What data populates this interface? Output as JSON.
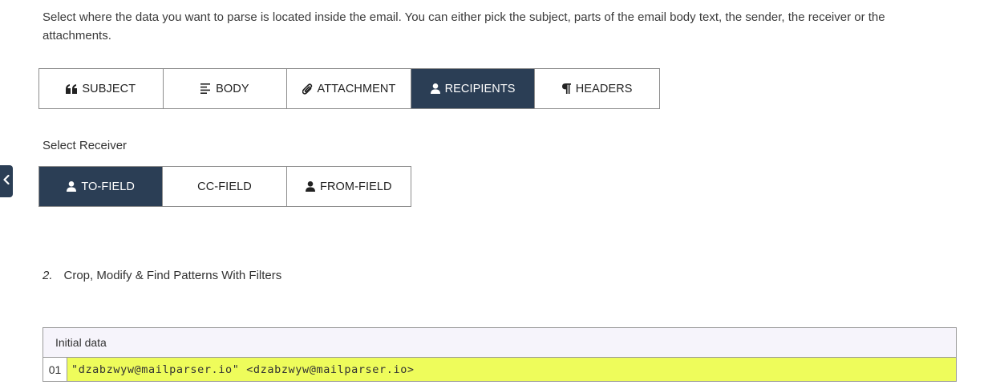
{
  "intro": {
    "text": "Select where the data you want to parse is located inside the email. You can either pick the subject, parts of the email body text, the sender, the receiver or the attachments."
  },
  "source_tabs": [
    {
      "label": "SUBJECT",
      "icon": "quote-icon",
      "active": false
    },
    {
      "label": "BODY",
      "icon": "align-left-icon",
      "active": false
    },
    {
      "label": "ATTACHMENT",
      "icon": "paperclip-icon",
      "active": false
    },
    {
      "label": "RECIPIENTS",
      "icon": "user-icon",
      "active": true
    },
    {
      "label": "HEADERS",
      "icon": "paragraph-icon",
      "active": false
    }
  ],
  "receiver": {
    "label": "Select Receiver",
    "tabs": [
      {
        "label": "TO-FIELD",
        "icon": "user-icon",
        "active": true
      },
      {
        "label": "CC-FIELD",
        "active": false
      },
      {
        "label": "FROM-FIELD",
        "icon": "user-icon",
        "active": false
      }
    ]
  },
  "step": {
    "number": "2.",
    "title": "Crop, Modify & Find Patterns With Filters"
  },
  "initial_data": {
    "header": "Initial data",
    "lines": [
      {
        "num": "01",
        "content": "\"dzabzwyw@mailparser.io\" <dzabzwyw@mailparser.io>"
      }
    ]
  },
  "colors": {
    "active_bg": "#2b3e55",
    "highlight": "#eefc5b",
    "header_bg": "#f6f4fb"
  }
}
